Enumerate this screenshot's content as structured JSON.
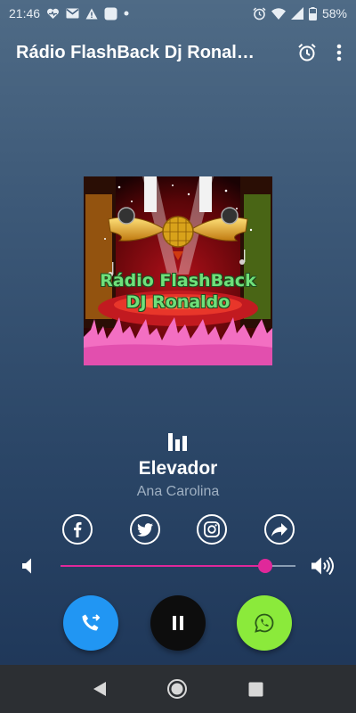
{
  "status_bar": {
    "time": "21:46",
    "battery": "58%",
    "icons_left": [
      "heart-monitor-icon",
      "gmail-icon",
      "warning-icon",
      "app-icon",
      "dot-icon"
    ],
    "icons_right": [
      "alarm-icon",
      "wifi-icon",
      "signal-icon",
      "battery-icon"
    ]
  },
  "app_bar": {
    "title": "Rádio FlashBack Dj Ronaldo",
    "actions": [
      "alarm-clock-icon",
      "more-vert-icon"
    ]
  },
  "cover": {
    "line1": "Rádio FlashBack",
    "line2": "DJ Ronaldo"
  },
  "now_playing": {
    "title": "Elevador",
    "artist": "Ana Carolina"
  },
  "share": [
    "facebook-icon",
    "twitter-icon",
    "instagram-icon",
    "share-icon"
  ],
  "volume": {
    "level": 0.87,
    "accent": "#e0289a"
  },
  "controls": {
    "call": {
      "icon": "phone-forward-icon",
      "color": "#2196f3"
    },
    "play_pause": {
      "icon": "pause-icon",
      "color": "#0d0d0d"
    },
    "whatsapp": {
      "icon": "whatsapp-icon",
      "color": "#8bea3b"
    }
  },
  "nav": [
    "back-icon",
    "home-icon",
    "recents-icon"
  ]
}
